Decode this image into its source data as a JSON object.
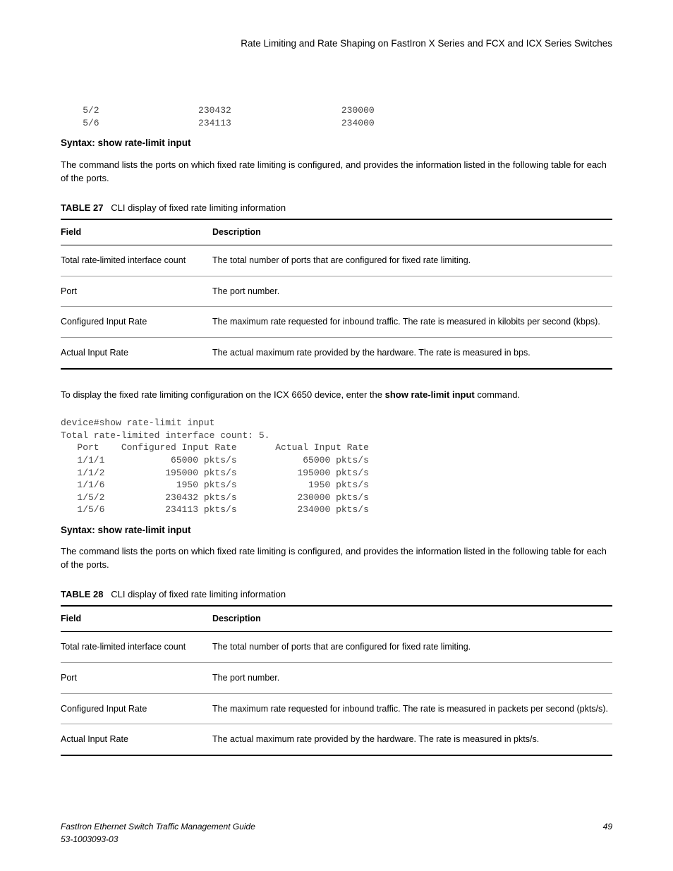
{
  "header": {
    "title": "Rate Limiting and Rate Shaping on FastIron X Series and FCX and ICX Series Switches"
  },
  "code1": "    5/2                  230432                    230000\n    5/6                  234113                    234000",
  "syntax1": "Syntax: show rate-limit input",
  "para1": "The command lists the ports on which fixed rate limiting is configured, and provides the information listed in the following table for each of the ports.",
  "table27": {
    "caption_bold": "TABLE 27",
    "caption_rest": "CLI display of fixed rate limiting information",
    "head_field": "Field",
    "head_desc": "Description",
    "rows": [
      {
        "field": "Total rate-limited interface count",
        "desc": "The total number of ports that are configured for fixed rate limiting."
      },
      {
        "field": "Port",
        "desc": "The port number."
      },
      {
        "field": "Configured Input Rate",
        "desc": "The maximum rate requested for inbound traffic. The rate is measured in kilobits per second (kbps)."
      },
      {
        "field": "Actual Input Rate",
        "desc": "The actual maximum rate provided by the hardware. The rate is measured in bps."
      }
    ]
  },
  "para2_a": "To display the fixed rate limiting configuration on the ICX 6650 device, enter the ",
  "para2_bold": "show rate-limit input",
  "para2_b": " command.",
  "code2": "device#show rate-limit input\nTotal rate-limited interface count: 5.\n   Port    Configured Input Rate       Actual Input Rate\n   1/1/1            65000 pkts/s            65000 pkts/s\n   1/1/2           195000 pkts/s           195000 pkts/s\n   1/1/6             1950 pkts/s             1950 pkts/s\n   1/5/2           230432 pkts/s           230000 pkts/s\n   1/5/6           234113 pkts/s           234000 pkts/s",
  "syntax2": "Syntax: show rate-limit input",
  "para3": "The command lists the ports on which fixed rate limiting is configured, and provides the information listed in the following table for each of the ports.",
  "table28": {
    "caption_bold": "TABLE 28",
    "caption_rest": "CLI display of fixed rate limiting information",
    "head_field": "Field",
    "head_desc": "Description",
    "rows": [
      {
        "field": "Total rate-limited interface count",
        "desc": "The total number of ports that are configured for fixed rate limiting."
      },
      {
        "field": "Port",
        "desc": "The port number."
      },
      {
        "field": "Configured Input Rate",
        "desc": "The maximum rate requested for inbound traffic. The rate is measured in packets per second (pkts/s)."
      },
      {
        "field": "Actual Input Rate",
        "desc": "The actual maximum rate provided by the hardware. The rate is measured in pkts/s."
      }
    ]
  },
  "footer": {
    "left1": "FastIron Ethernet Switch Traffic Management Guide",
    "left2": "53-1003093-03",
    "page": "49"
  }
}
